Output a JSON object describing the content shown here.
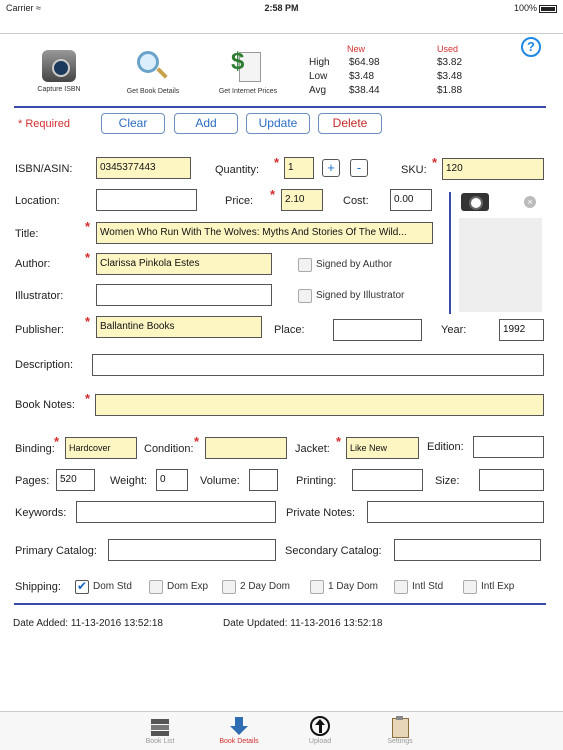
{
  "status": {
    "carrier": "Carrier",
    "wifi_icon": "wifi-icon",
    "time": "2:58 PM",
    "battery": "100%"
  },
  "toolbar": {
    "capture_isbn": "Capture ISBN",
    "get_book_details": "Get Book Details",
    "get_internet_prices": "Get Internet Prices",
    "help": "?"
  },
  "prices": {
    "new_header": "New",
    "used_header": "Used",
    "rows": [
      {
        "label": "High",
        "new": "$64.98",
        "used": "$3.82"
      },
      {
        "label": "Low",
        "new": "$3.48",
        "used": "$3.48"
      },
      {
        "label": "Avg",
        "new": "$38.44",
        "used": "$1.88"
      }
    ]
  },
  "actions": {
    "required": "* Required",
    "clear": "Clear",
    "add": "Add",
    "update": "Update",
    "delete": "Delete"
  },
  "form": {
    "isbn_label": "ISBN/ASIN:",
    "isbn_value": "0345377443",
    "quantity_label": "Quantity:",
    "quantity_value": "1",
    "plus": "+",
    "minus": "-",
    "sku_label": "SKU:",
    "sku_value": "120",
    "location_label": "Location:",
    "location_value": "",
    "price_label": "Price:",
    "price_value": "2.10",
    "cost_label": "Cost:",
    "cost_value": "0.00",
    "title_label": "Title:",
    "title_value": "Women Who Run With The Wolves:  Myths And Stories Of The Wild...",
    "author_label": "Author:",
    "author_value": "Clarissa Pinkola Estes",
    "signed_author_label": "Signed by Author",
    "illustrator_label": "Illustrator:",
    "illustrator_value": "",
    "signed_illustrator_label": "Signed by Illustrator",
    "publisher_label": "Publisher:",
    "publisher_value": "Ballantine Books",
    "place_label": "Place:",
    "place_value": "",
    "year_label": "Year:",
    "year_value": "1992",
    "description_label": "Description:",
    "description_value": "",
    "book_notes_label": "Book Notes:",
    "book_notes_value": "",
    "binding_label": "Binding:",
    "binding_value": "Hardcover",
    "condition_label": "Condition:",
    "condition_value": "",
    "jacket_label": "Jacket:",
    "jacket_value": "Like New",
    "edition_label": "Edition:",
    "edition_value": "",
    "pages_label": "Pages:",
    "pages_value": "520",
    "weight_label": "Weight:",
    "weight_value": "0",
    "volume_label": "Volume:",
    "volume_value": "",
    "printing_label": "Printing:",
    "printing_value": "",
    "size_label": "Size:",
    "size_value": "",
    "keywords_label": "Keywords:",
    "keywords_value": "",
    "private_notes_label": "Private Notes:",
    "private_notes_value": "",
    "primary_catalog_label": "Primary Catalog:",
    "primary_catalog_value": "",
    "secondary_catalog_label": "Secondary Catalog:",
    "secondary_catalog_value": "",
    "shipping_label": "Shipping:",
    "shipping_options": [
      {
        "label": "Dom Std",
        "checked": true
      },
      {
        "label": "Dom Exp",
        "checked": false
      },
      {
        "label": "2 Day Dom",
        "checked": false
      },
      {
        "label": "1 Day Dom",
        "checked": false
      },
      {
        "label": "Intl Std",
        "checked": false
      },
      {
        "label": "Intl Exp",
        "checked": false
      }
    ]
  },
  "dates": {
    "added": "Date Added: 11-13-2016 13:52:18",
    "updated": "Date Updated: 11-13-2016 13:52:18"
  },
  "tabs": [
    {
      "label": "Book List",
      "icon": "books-icon",
      "active": false
    },
    {
      "label": "Book Details",
      "icon": "download-arrow-icon",
      "active": true
    },
    {
      "label": "Upload",
      "icon": "upload-icon",
      "active": false
    },
    {
      "label": "Settings",
      "icon": "clipboard-icon",
      "active": false
    }
  ],
  "colors": {
    "accent": "#2a6cc4",
    "required": "#d32f2f",
    "required_field_bg": "#fdf6c3",
    "divider": "#3a4aa8"
  }
}
